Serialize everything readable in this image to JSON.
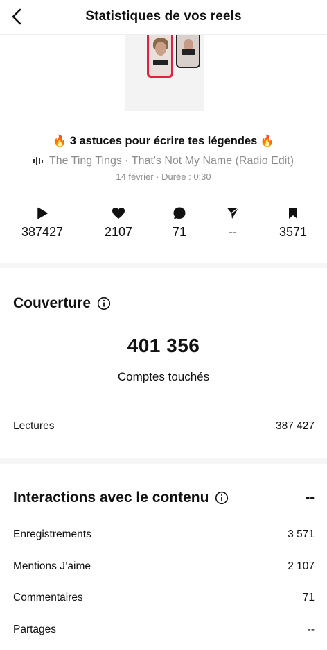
{
  "header": {
    "title": "Statistiques de vos reels"
  },
  "reel": {
    "title": "3 astuces pour écrire tes légendes",
    "title_emoji": "🔥",
    "audio": "The Ting Tings · That's Not My Name (Radio Edit)",
    "date_duration": "14 février · Durée : 0:30"
  },
  "stats": [
    {
      "icon": "play-icon",
      "value": "387427"
    },
    {
      "icon": "heart-icon",
      "value": "2107"
    },
    {
      "icon": "comment-icon",
      "value": "71"
    },
    {
      "icon": "share-icon",
      "value": "--"
    },
    {
      "icon": "bookmark-icon",
      "value": "3571"
    }
  ],
  "coverage": {
    "title": "Couverture",
    "accounts_reached_value": "401 356",
    "accounts_reached_label": "Comptes touchés",
    "plays_label": "Lectures",
    "plays_value": "387 427"
  },
  "interactions": {
    "title": "Interactions avec le contenu",
    "total": "--",
    "rows": [
      {
        "label": "Enregistrements",
        "value": "3 571"
      },
      {
        "label": "Mentions J’aime",
        "value": "2 107"
      },
      {
        "label": "Commentaires",
        "value": "71"
      },
      {
        "label": "Partages",
        "value": "--"
      }
    ]
  }
}
